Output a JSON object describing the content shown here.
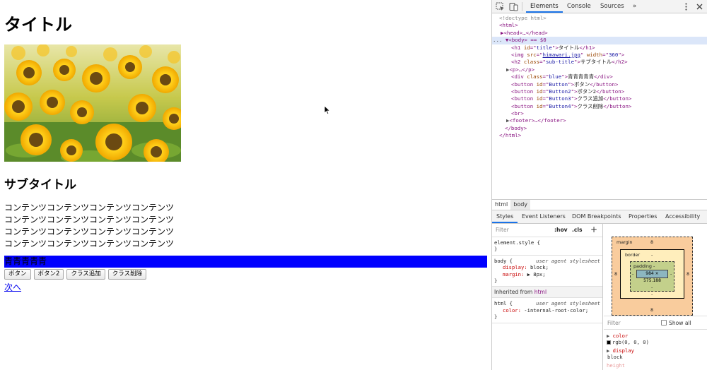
{
  "page": {
    "title": "タイトル",
    "image_alt": "himawari sunflowers",
    "subtitle": "サブタイトル",
    "content_lines": [
      "コンテンツコンテンツコンテンツコンテンツ",
      "コンテンツコンテンツコンテンツコンテンツ",
      "コンテンツコンテンツコンテンツコンテンツ",
      "コンテンツコンテンツコンテンツコンテンツ"
    ],
    "blue_text": "青青青青青",
    "buttons": [
      "ボタン",
      "ボタン2",
      "クラス追加",
      "クラス削除"
    ],
    "next_link": "次へ",
    "blue_color": "#0000ff"
  },
  "devtools": {
    "tabs": [
      "Elements",
      "Console",
      "Sources"
    ],
    "more": "»",
    "dom": {
      "doctype": "<!doctype html>",
      "html_open": "<html>",
      "head": "▶<head>…</head>",
      "body_prefix": "...",
      "body_line": "<body> == $0",
      "h1": {
        "id": "title",
        "text": "タイトル"
      },
      "img": {
        "src": "himawari.jpg",
        "width": "360"
      },
      "h2": {
        "class": "sub-title",
        "text": "サブタイトル"
      },
      "p": "<p>…</p>",
      "div": {
        "class": "blue",
        "text": "青青青青青"
      },
      "buttons": [
        {
          "id": "Button",
          "text": "ボタン"
        },
        {
          "id": "Button2",
          "text": "ボタン2"
        },
        {
          "id": "Button3",
          "text": "クラス追加"
        },
        {
          "id": "Button4",
          "text": "クラス削除"
        }
      ],
      "br": "<br>",
      "footer": "<footer>…</footer>",
      "body_close": "</body>",
      "html_close": "</html>"
    },
    "breadcrumbs": [
      "html",
      "body"
    ],
    "panel_tabs": [
      "Styles",
      "Event Listeners",
      "DOM Breakpoints",
      "Properties",
      "Accessibility"
    ],
    "styles": {
      "filter_placeholder": "Filter",
      "hov": ":hov",
      "cls": ".cls",
      "plus": "+",
      "element_style": "element.style {",
      "close_brace": "}",
      "body_rule": {
        "selector": "body {",
        "source": "user agent stylesheet",
        "props": [
          {
            "name": "display",
            "value": "block;"
          },
          {
            "name": "margin",
            "value": "▶ 8px;"
          }
        ]
      },
      "inherited_label": "Inherited from",
      "inherited_tag": "html",
      "html_rule": {
        "selector": "html {",
        "source": "user agent stylesheet",
        "props": [
          {
            "name": "color",
            "value": "-internal-root-color;"
          }
        ]
      }
    },
    "box_model": {
      "margin_label": "margin",
      "margin_value": "8",
      "border_label": "border",
      "border_value": "-",
      "padding_label": "padding -",
      "content": "984 × 575.188",
      "side_dash": "-",
      "bottom_dash": "-"
    },
    "computed": {
      "filter_placeholder": "Filter",
      "show_all": "Show all",
      "props": [
        {
          "name": "color",
          "value": "rgb(0, 0, 0)"
        },
        {
          "name": "display",
          "value": "block"
        },
        {
          "name": "height",
          "value": ""
        }
      ]
    }
  }
}
